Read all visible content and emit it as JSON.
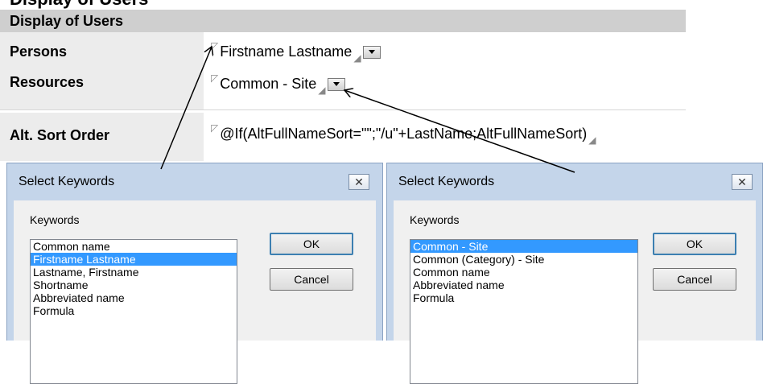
{
  "form": {
    "cutoff_title": "Display of Users",
    "section_title": "Display of Users",
    "persons": {
      "label": "Persons",
      "value": "Firstname Lastname"
    },
    "resources": {
      "label": "Resources",
      "value": "Common - Site"
    },
    "alt_sort": {
      "label": "Alt. Sort Order",
      "value": "@If(AltFullNameSort=\"\";\"/u\"+LastName;AltFullNameSort)"
    },
    "field_start_marker": "◸",
    "field_end_marker": "◢"
  },
  "dialog_left": {
    "title": "Select Keywords",
    "close_glyph": "✕",
    "keywords_label": "Keywords",
    "ok_label": "OK",
    "cancel_label": "Cancel",
    "items": [
      "Common name",
      "Firstname Lastname",
      "Lastname, Firstname",
      "Shortname",
      "Abbreviated name",
      "Formula"
    ],
    "selected_index": 1
  },
  "dialog_right": {
    "title": "Select Keywords",
    "close_glyph": "✕",
    "keywords_label": "Keywords",
    "ok_label": "OK",
    "cancel_label": "Cancel",
    "items": [
      "Common - Site",
      "Common (Category) - Site",
      "Common name",
      "Abbreviated name",
      "Formula"
    ],
    "selected_index": 0
  },
  "colors": {
    "section_bar": "#cfcfcf",
    "label_column": "#ececec",
    "dialog_frame": "#c4d5ea",
    "selection": "#3399ff"
  }
}
